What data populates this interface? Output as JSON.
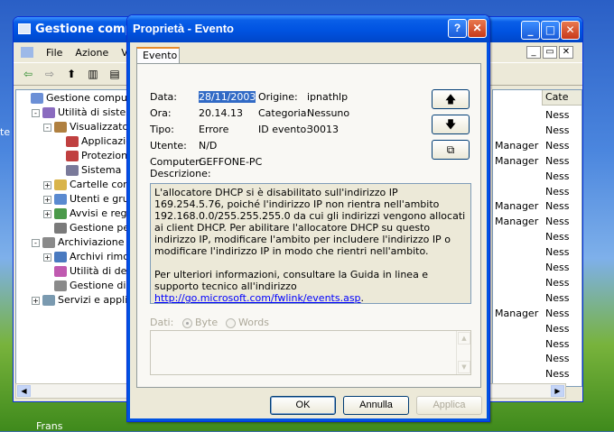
{
  "desktop": {
    "left_label": "te",
    "bottom_label": "Frans"
  },
  "mmc": {
    "title": "Gestione computer",
    "menu": [
      "File",
      "Azione",
      "Visu"
    ],
    "tree": [
      {
        "label": "Gestione computer (lo",
        "indent": 0,
        "exp": ""
      },
      {
        "label": "Utilità di sistema",
        "indent": 1,
        "exp": "-"
      },
      {
        "label": "Visualizzatore",
        "indent": 2,
        "exp": "-"
      },
      {
        "label": "Applicazio",
        "indent": 3,
        "exp": ""
      },
      {
        "label": "Protezion",
        "indent": 3,
        "exp": ""
      },
      {
        "label": "Sistema",
        "indent": 3,
        "exp": ""
      },
      {
        "label": "Cartelle cond",
        "indent": 2,
        "exp": "+"
      },
      {
        "label": "Utenti e grup",
        "indent": 2,
        "exp": "+"
      },
      {
        "label": "Avvisi e regis",
        "indent": 2,
        "exp": "+"
      },
      {
        "label": "Gestione peri",
        "indent": 2,
        "exp": ""
      },
      {
        "label": "Archiviazione",
        "indent": 1,
        "exp": "-"
      },
      {
        "label": "Archivi rimovi",
        "indent": 2,
        "exp": "+"
      },
      {
        "label": "Utilità di defra",
        "indent": 2,
        "exp": ""
      },
      {
        "label": "Gestione disc",
        "indent": 2,
        "exp": ""
      },
      {
        "label": "Servizi e applicazi",
        "indent": 1,
        "exp": "+"
      }
    ],
    "right_header": "Cate",
    "right_rows": [
      {
        "user": "",
        "cat": "Ness"
      },
      {
        "user": "",
        "cat": "Ness"
      },
      {
        "user": "Manager",
        "cat": "Ness"
      },
      {
        "user": "Manager",
        "cat": "Ness"
      },
      {
        "user": "",
        "cat": "Ness"
      },
      {
        "user": "",
        "cat": "Ness"
      },
      {
        "user": "Manager",
        "cat": "Ness"
      },
      {
        "user": "Manager",
        "cat": "Ness"
      },
      {
        "user": "",
        "cat": "Ness"
      },
      {
        "user": "",
        "cat": "Ness"
      },
      {
        "user": "",
        "cat": "Ness"
      },
      {
        "user": "",
        "cat": "Ness"
      },
      {
        "user": "",
        "cat": "Ness"
      },
      {
        "user": "Manager",
        "cat": "Ness"
      },
      {
        "user": "",
        "cat": "Ness"
      },
      {
        "user": "",
        "cat": "Ness"
      },
      {
        "user": "",
        "cat": "Ness"
      },
      {
        "user": "",
        "cat": "Ness"
      }
    ]
  },
  "dialog": {
    "title": "Proprietà - Evento",
    "help_glyph": "?",
    "close_glyph": "✕",
    "tab": "Evento",
    "fields": {
      "data_label": "Data:",
      "data_value": "28/11/2003",
      "ora_label": "Ora:",
      "ora_value": "20.14.13",
      "tipo_label": "Tipo:",
      "tipo_value": "Errore",
      "utente_label": "Utente:",
      "utente_value": "N/D",
      "computer_label": "Computer:",
      "computer_value": "GEFFONE-PC",
      "origine_label": "Origine:",
      "origine_value": "ipnathlp",
      "categoria_label": "Categoria:",
      "categoria_value": "Nessuno",
      "id_label": "ID evento:",
      "id_value": "30013"
    },
    "desc_label": "Descrizione:",
    "desc_p1": "L'allocatore DHCP si è disabilitato sull'indirizzo IP 169.254.5.76, poiché l'indirizzo IP non rientra nell'ambito 192.168.0.0/255.255.255.0 da cui gli indirizzi vengono allocati ai client DHCP. Per abilitare l'allocatore DHCP su questo indirizzo IP, modificare l'ambito per includere l'indirizzo IP o modificare l'indirizzo IP in modo che rientri nell'ambito.",
    "desc_p2": "Per ulteriori informazioni, consultare la Guida in linea e supporto tecnico all'indirizzo ",
    "desc_link": "http://go.microsoft.com/fwlink/events.asp",
    "desc_end": ".",
    "dati_label": "Dati:",
    "radio_byte": "Byte",
    "radio_words": "Words",
    "ok": "OK",
    "cancel": "Annulla",
    "apply": "Applica"
  }
}
